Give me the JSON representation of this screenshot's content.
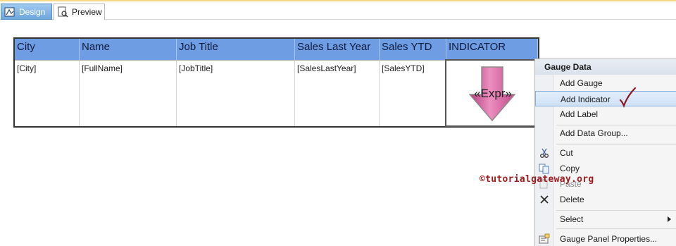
{
  "tabs": [
    {
      "label": "Design",
      "active": true,
      "icon": "design-icon"
    },
    {
      "label": "Preview",
      "active": false,
      "icon": "preview-icon"
    }
  ],
  "table": {
    "headers": [
      "City",
      "Name",
      "Job Title",
      "Sales Last Year",
      "Sales YTD",
      "INDICATOR"
    ],
    "cells": [
      "[City]",
      "[FullName]",
      "[JobTitle]",
      "[SalesLastYear]",
      "[SalesYTD]",
      "«Expr»"
    ]
  },
  "context_menu": {
    "header": "Gauge Data",
    "items": [
      {
        "label": "Add Gauge"
      },
      {
        "label": "Add Indicator",
        "highlighted": true
      },
      {
        "label": "Add Label"
      },
      {
        "label": "Add Data Group..."
      },
      {
        "label": "Cut",
        "icon": "scissors-icon"
      },
      {
        "label": "Copy",
        "icon": "copy-icon"
      },
      {
        "label": "Paste",
        "icon": "paste-icon",
        "disabled": true
      },
      {
        "label": "Delete",
        "icon": "delete-icon"
      },
      {
        "label": "Select",
        "submenu": true
      },
      {
        "label": "Gauge Panel Properties...",
        "icon": "properties-icon"
      }
    ]
  },
  "watermark": "©tutorialgateway.org",
  "colors": {
    "header_fill": "#6e9de4",
    "active_tab": "#6fa8dc",
    "indicator_arrow": "#d9609e",
    "watermark": "#9b1c1c"
  }
}
